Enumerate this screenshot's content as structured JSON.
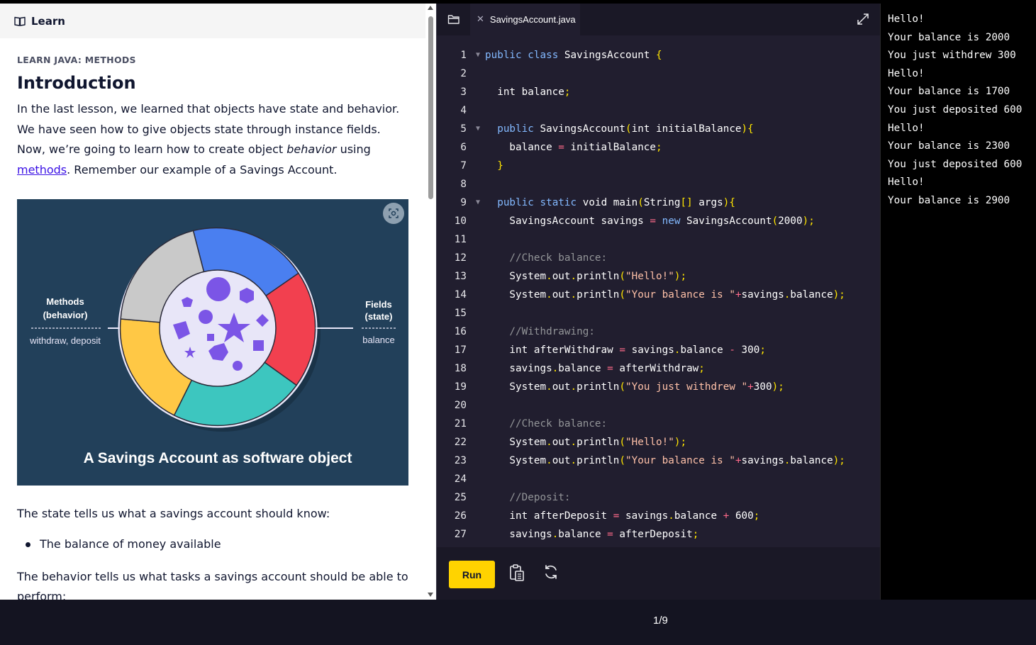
{
  "learn": {
    "header_title": "Learn",
    "kicker": "LEARN JAVA: METHODS",
    "heading": "Introduction",
    "intro_part1": "In the last lesson, we learned that objects have state and behavior. We have seen how to give objects state through instance fields. Now, we’re going to learn how to create object ",
    "intro_em": "behavior",
    "intro_part2": " using ",
    "intro_link": "methods",
    "intro_part3": ". Remember our example of a Savings Account.",
    "figure": {
      "left_label_line1": "Methods",
      "left_label_line2": "(behavior)",
      "left_caption": "withdraw, deposit",
      "right_label_line1": "Fields",
      "right_label_line2": "(state)",
      "right_caption": "balance",
      "caption": "A Savings Account as software object",
      "colors": {
        "bg": "#22405a",
        "blue": "#4a7ff0",
        "red": "#f2404f",
        "teal": "#3dc6bf",
        "yellow": "#ffc845",
        "gray": "#c9c9c9",
        "purple": "#7b55e6",
        "center": "#e8e6f8"
      }
    },
    "state_text": "The state tells us what a savings account should know:",
    "bullet_1": "The balance of money available",
    "behavior_text": "The behavior tells us what tasks a savings account should be able to perform:"
  },
  "editor": {
    "tab_name": "SavingsAccount.java",
    "run_label": "Run",
    "lines": [
      {
        "n": "1",
        "fold": true,
        "code": [
          [
            "kw",
            "public"
          ],
          [
            "p",
            " "
          ],
          [
            "kw",
            "class"
          ],
          [
            "p",
            " SavingsAccount "
          ],
          [
            "br",
            "{"
          ]
        ]
      },
      {
        "n": "2",
        "fold": false,
        "code": []
      },
      {
        "n": "3",
        "fold": false,
        "code": [
          [
            "p",
            "  int balance"
          ],
          [
            "pu",
            ";"
          ]
        ]
      },
      {
        "n": "4",
        "fold": false,
        "code": []
      },
      {
        "n": "5",
        "fold": true,
        "code": [
          [
            "p",
            "  "
          ],
          [
            "kw",
            "public"
          ],
          [
            "p",
            " SavingsAccount"
          ],
          [
            "br",
            "("
          ],
          [
            "p",
            "int initialBalance"
          ],
          [
            "br",
            "){"
          ]
        ]
      },
      {
        "n": "6",
        "fold": false,
        "code": [
          [
            "p",
            "    balance "
          ],
          [
            "op",
            "="
          ],
          [
            "p",
            " initialBalance"
          ],
          [
            "pu",
            ";"
          ]
        ]
      },
      {
        "n": "7",
        "fold": false,
        "code": [
          [
            "p",
            "  "
          ],
          [
            "br",
            "}"
          ]
        ]
      },
      {
        "n": "8",
        "fold": false,
        "code": []
      },
      {
        "n": "9",
        "fold": true,
        "code": [
          [
            "p",
            "  "
          ],
          [
            "kw",
            "public"
          ],
          [
            "p",
            " "
          ],
          [
            "kw",
            "static"
          ],
          [
            "p",
            " void main"
          ],
          [
            "br",
            "("
          ],
          [
            "p",
            "String"
          ],
          [
            "br",
            "[]"
          ],
          [
            "p",
            " args"
          ],
          [
            "br",
            "){"
          ]
        ]
      },
      {
        "n": "10",
        "fold": false,
        "code": [
          [
            "p",
            "    SavingsAccount savings "
          ],
          [
            "op",
            "="
          ],
          [
            "p",
            " "
          ],
          [
            "kw",
            "new"
          ],
          [
            "p",
            " SavingsAccount"
          ],
          [
            "br",
            "("
          ],
          [
            "p",
            "2000"
          ],
          [
            "br",
            ")"
          ],
          [
            "pu",
            ";"
          ]
        ]
      },
      {
        "n": "11",
        "fold": false,
        "code": []
      },
      {
        "n": "12",
        "fold": false,
        "code": [
          [
            "cm",
            "    //Check balance:"
          ]
        ]
      },
      {
        "n": "13",
        "fold": false,
        "code": [
          [
            "p",
            "    System"
          ],
          [
            "pu",
            "."
          ],
          [
            "p",
            "out"
          ],
          [
            "pu",
            "."
          ],
          [
            "p",
            "println"
          ],
          [
            "br",
            "("
          ],
          [
            "st",
            "\"Hello!\""
          ],
          [
            "br",
            ")"
          ],
          [
            "pu",
            ";"
          ]
        ]
      },
      {
        "n": "14",
        "fold": false,
        "code": [
          [
            "p",
            "    System"
          ],
          [
            "pu",
            "."
          ],
          [
            "p",
            "out"
          ],
          [
            "pu",
            "."
          ],
          [
            "p",
            "println"
          ],
          [
            "br",
            "("
          ],
          [
            "st",
            "\"Your balance is \""
          ],
          [
            "op",
            "+"
          ],
          [
            "p",
            "savings"
          ],
          [
            "pu",
            "."
          ],
          [
            "p",
            "balance"
          ],
          [
            "br",
            ")"
          ],
          [
            "pu",
            ";"
          ]
        ]
      },
      {
        "n": "15",
        "fold": false,
        "code": []
      },
      {
        "n": "16",
        "fold": false,
        "code": [
          [
            "cm",
            "    //Withdrawing:"
          ]
        ]
      },
      {
        "n": "17",
        "fold": false,
        "code": [
          [
            "p",
            "    int afterWithdraw "
          ],
          [
            "op",
            "="
          ],
          [
            "p",
            " savings"
          ],
          [
            "pu",
            "."
          ],
          [
            "p",
            "balance "
          ],
          [
            "op",
            "-"
          ],
          [
            "p",
            " 300"
          ],
          [
            "pu",
            ";"
          ]
        ]
      },
      {
        "n": "18",
        "fold": false,
        "code": [
          [
            "p",
            "    savings"
          ],
          [
            "pu",
            "."
          ],
          [
            "p",
            "balance "
          ],
          [
            "op",
            "="
          ],
          [
            "p",
            " afterWithdraw"
          ],
          [
            "pu",
            ";"
          ]
        ]
      },
      {
        "n": "19",
        "fold": false,
        "code": [
          [
            "p",
            "    System"
          ],
          [
            "pu",
            "."
          ],
          [
            "p",
            "out"
          ],
          [
            "pu",
            "."
          ],
          [
            "p",
            "println"
          ],
          [
            "br",
            "("
          ],
          [
            "st",
            "\"You just withdrew \""
          ],
          [
            "op",
            "+"
          ],
          [
            "p",
            "300"
          ],
          [
            "br",
            ")"
          ],
          [
            "pu",
            ";"
          ]
        ]
      },
      {
        "n": "20",
        "fold": false,
        "code": []
      },
      {
        "n": "21",
        "fold": false,
        "code": [
          [
            "cm",
            "    //Check balance:"
          ]
        ]
      },
      {
        "n": "22",
        "fold": false,
        "code": [
          [
            "p",
            "    System"
          ],
          [
            "pu",
            "."
          ],
          [
            "p",
            "out"
          ],
          [
            "pu",
            "."
          ],
          [
            "p",
            "println"
          ],
          [
            "br",
            "("
          ],
          [
            "st",
            "\"Hello!\""
          ],
          [
            "br",
            ")"
          ],
          [
            "pu",
            ";"
          ]
        ]
      },
      {
        "n": "23",
        "fold": false,
        "code": [
          [
            "p",
            "    System"
          ],
          [
            "pu",
            "."
          ],
          [
            "p",
            "out"
          ],
          [
            "pu",
            "."
          ],
          [
            "p",
            "println"
          ],
          [
            "br",
            "("
          ],
          [
            "st",
            "\"Your balance is \""
          ],
          [
            "op",
            "+"
          ],
          [
            "p",
            "savings"
          ],
          [
            "pu",
            "."
          ],
          [
            "p",
            "balance"
          ],
          [
            "br",
            ")"
          ],
          [
            "pu",
            ";"
          ]
        ]
      },
      {
        "n": "24",
        "fold": false,
        "code": []
      },
      {
        "n": "25",
        "fold": false,
        "code": [
          [
            "cm",
            "    //Deposit:"
          ]
        ]
      },
      {
        "n": "26",
        "fold": false,
        "code": [
          [
            "p",
            "    int afterDeposit "
          ],
          [
            "op",
            "="
          ],
          [
            "p",
            " savings"
          ],
          [
            "pu",
            "."
          ],
          [
            "p",
            "balance "
          ],
          [
            "op",
            "+"
          ],
          [
            "p",
            " 600"
          ],
          [
            "pu",
            ";"
          ]
        ]
      },
      {
        "n": "27",
        "fold": false,
        "code": [
          [
            "p",
            "    savings"
          ],
          [
            "pu",
            "."
          ],
          [
            "p",
            "balance "
          ],
          [
            "op",
            "="
          ],
          [
            "p",
            " afterDeposit"
          ],
          [
            "pu",
            ";"
          ]
        ]
      }
    ],
    "syntax_colors": {
      "kw": "#83b9ff",
      "p": "#ffffff",
      "br": "#ffe500",
      "pu": "#ffe500",
      "op": "#ff6a8a",
      "st": "#ffc1a8",
      "cm": "#939598"
    }
  },
  "console": {
    "lines": [
      "Hello!",
      "Your balance is 2000",
      "You just withdrew 300",
      "Hello!",
      "Your balance is 1700",
      "You just deposited 600",
      "Hello!",
      "Your balance is 2300",
      "You just deposited 600",
      "Hello!",
      "Your balance is 2900"
    ]
  },
  "footer": {
    "page_indicator": "1/9"
  }
}
